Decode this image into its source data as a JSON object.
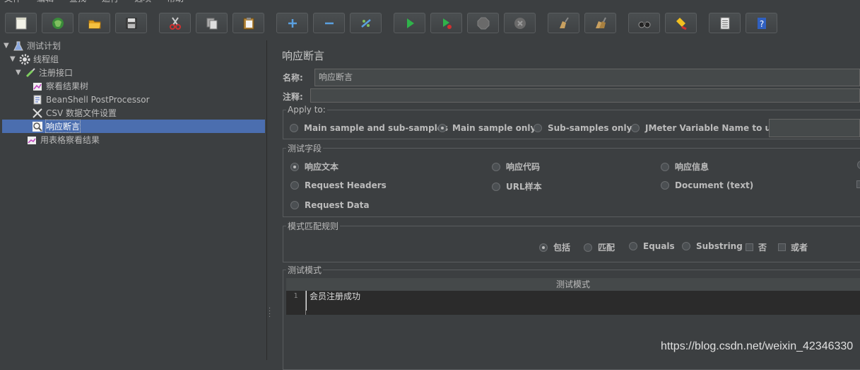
{
  "menu": [
    "文件",
    "编辑",
    "查找",
    "运行",
    "选项",
    "帮助"
  ],
  "toolbar": {
    "buttons": [
      {
        "name": "new-icon"
      },
      {
        "name": "templates-icon"
      },
      {
        "name": "open-icon"
      },
      {
        "name": "save-icon"
      },
      {
        "name": "cut-icon"
      },
      {
        "name": "copy-icon"
      },
      {
        "name": "paste-icon"
      },
      {
        "name": "expand-icon",
        "glyph": "+"
      },
      {
        "name": "collapse-icon",
        "glyph": "−"
      },
      {
        "name": "toggle-icon"
      },
      {
        "name": "start-icon"
      },
      {
        "name": "start-no-pause-icon"
      },
      {
        "name": "stop-icon"
      },
      {
        "name": "shutdown-icon"
      },
      {
        "name": "clear-icon"
      },
      {
        "name": "clear-all-icon"
      },
      {
        "name": "search-icon"
      },
      {
        "name": "reset-search-icon"
      },
      {
        "name": "function-helper-icon"
      },
      {
        "name": "help-icon",
        "glyph": "?"
      }
    ]
  },
  "tree": {
    "items": [
      {
        "label": "测试计划"
      },
      {
        "label": "线程组"
      },
      {
        "label": "注册接口"
      },
      {
        "label": "察看结果树"
      },
      {
        "label": "BeanShell PostProcessor"
      },
      {
        "label": "CSV 数据文件设置"
      },
      {
        "label": "响应断言"
      },
      {
        "label": "用表格察看结果"
      }
    ],
    "selected_index": 6
  },
  "panel": {
    "title": "响应断言",
    "name_label": "名称:",
    "name_value": "响应断言",
    "comment_label": "注释:",
    "comment_value": "",
    "apply_to": {
      "legend": "Apply to:",
      "options": [
        "Main sample and sub-samples",
        "Main sample only",
        "Sub-samples only",
        "JMeter Variable Name to use"
      ],
      "selected": "Main sample only",
      "variable_value": ""
    },
    "test_field": {
      "legend": "测试字段",
      "options": [
        "响应文本",
        "响应代码",
        "响应信息",
        "Request Headers",
        "URL样本",
        "Document (text)",
        "Request Data"
      ],
      "selected": "响应文本"
    },
    "pattern_rule": {
      "legend": "模式匹配规则",
      "radios": [
        "包括",
        "匹配",
        "Equals",
        "Substring"
      ],
      "selected": "包括",
      "checks": [
        "否",
        "或者"
      ]
    },
    "patterns": {
      "legend": "测试模式",
      "column": "测试模式",
      "line_number": "1",
      "value": "会员注册成功"
    }
  },
  "watermark": "https://blog.csdn.net/weixin_42346330"
}
